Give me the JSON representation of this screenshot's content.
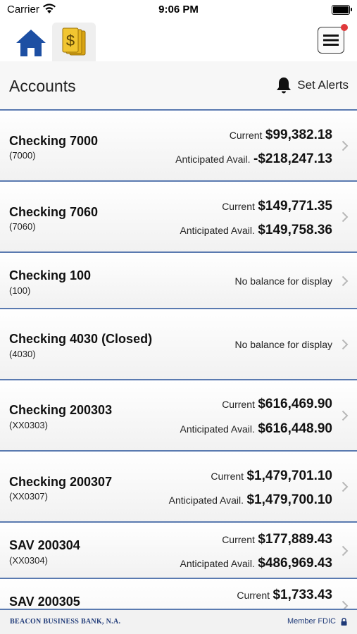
{
  "status_bar": {
    "carrier": "Carrier",
    "time": "9:06 PM"
  },
  "page": {
    "title": "Accounts",
    "alerts_label": "Set Alerts"
  },
  "accounts": [
    {
      "name": "Checking 7000",
      "number": "(7000)",
      "current_label": "Current",
      "current": "$99,382.18",
      "anticipated_label": "Anticipated Avail.",
      "anticipated": "-$218,247.13"
    },
    {
      "name": "Checking 7060",
      "number": "(7060)",
      "current_label": "Current",
      "current": "$149,771.35",
      "anticipated_label": "Anticipated Avail.",
      "anticipated": "$149,758.36"
    },
    {
      "name": "Checking 100",
      "number": "(100)",
      "no_balance": "No balance for display"
    },
    {
      "name": "Checking 4030 (Closed)",
      "number": "(4030)",
      "no_balance": "No balance for display"
    },
    {
      "name": "Checking 200303",
      "number": "(XX0303)",
      "current_label": "Current",
      "current": "$616,469.90",
      "anticipated_label": "Anticipated Avail.",
      "anticipated": "$616,448.90"
    },
    {
      "name": "Checking 200307",
      "number": "(XX0307)",
      "current_label": "Current",
      "current": "$1,479,701.10",
      "anticipated_label": "Anticipated Avail.",
      "anticipated": "$1,479,700.10"
    },
    {
      "name": "SAV 200304",
      "number": "(XX0304)",
      "current_label": "Current",
      "current": "$177,889.43",
      "anticipated_label": "Anticipated Avail.",
      "anticipated": "$486,969.43"
    },
    {
      "name": "SAV 200305",
      "number": "",
      "current_label": "Current",
      "current": "$1,733.43"
    }
  ],
  "footer": {
    "bank_name": "BEACON BUSINESS BANK, N.A.",
    "fdic": "Member FDIC"
  },
  "colors": {
    "divider": "#5a7ab0",
    "brand_navy": "#1f3a78",
    "home_blue": "#1d4fa3",
    "money_gold": "#e3b21a",
    "notify_red": "#e0393b"
  },
  "icons": {
    "home": "home-icon",
    "money": "money-icon",
    "menu": "hamburger-menu-icon",
    "alerts": "bell-icon",
    "chevron": "chevron-right-icon",
    "lock": "lock-icon"
  }
}
